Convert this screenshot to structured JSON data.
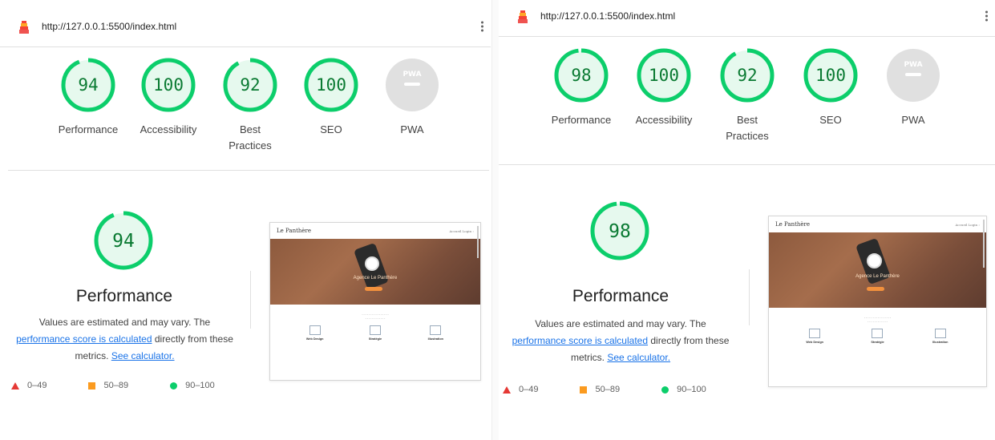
{
  "colors": {
    "pass": "#0cce6b",
    "pass_text": "#0a7a32",
    "average": "#fb9b20",
    "fail": "#e53935",
    "pwa_grey": "#e0e0e0",
    "link": "#1a73e8"
  },
  "left": {
    "url": "http://127.0.0.1:5500/index.html",
    "gauges": [
      {
        "score": "94",
        "value": 94,
        "label": "Performance"
      },
      {
        "score": "100",
        "value": 100,
        "label": "Accessibility"
      },
      {
        "score": "92",
        "value": 92,
        "label": "Best Practices"
      },
      {
        "score": "100",
        "value": 100,
        "label": "SEO"
      },
      {
        "score": "PWA",
        "label": "PWA"
      }
    ],
    "performance": {
      "score": "94",
      "value": 94,
      "title": "Performance",
      "desc_line1": "Values are estimated and may vary. The",
      "calc_link": "performance score is calculated",
      "desc_after_link": " directly from these",
      "desc_line3": "metrics. ",
      "calculator_link": "See calculator."
    },
    "legend": [
      "0–49",
      "50–89",
      "90–100"
    ],
    "screenshot": {
      "logo": "Le Panthère",
      "links": "Accueil   Login ›",
      "hero_title": "Agence Le Panthère",
      "cols": [
        "Web Design",
        "Stratégie",
        "Illustration"
      ]
    }
  },
  "right": {
    "url": "http://127.0.0.1:5500/index.html",
    "gauges": [
      {
        "score": "98",
        "value": 98,
        "label": "Performance"
      },
      {
        "score": "100",
        "value": 100,
        "label": "Accessibility"
      },
      {
        "score": "92",
        "value": 92,
        "label": "Best Practices"
      },
      {
        "score": "100",
        "value": 100,
        "label": "SEO"
      },
      {
        "score": "PWA",
        "label": "PWA"
      }
    ],
    "performance": {
      "score": "98",
      "value": 98,
      "title": "Performance",
      "desc_line1": "Values are estimated and may vary. The",
      "calc_link": "performance score is calculated",
      "desc_after_link": " directly from these",
      "desc_line3": "metrics. ",
      "calculator_link": "See calculator."
    },
    "legend": [
      "0–49",
      "50–89",
      "90–100"
    ],
    "screenshot": {
      "logo": "Le Panthère",
      "links": "Accueil   Login ›",
      "hero_title": "Agence Le Panthère",
      "cols": [
        "Web Design",
        "Stratégie",
        "Illustration"
      ]
    }
  }
}
